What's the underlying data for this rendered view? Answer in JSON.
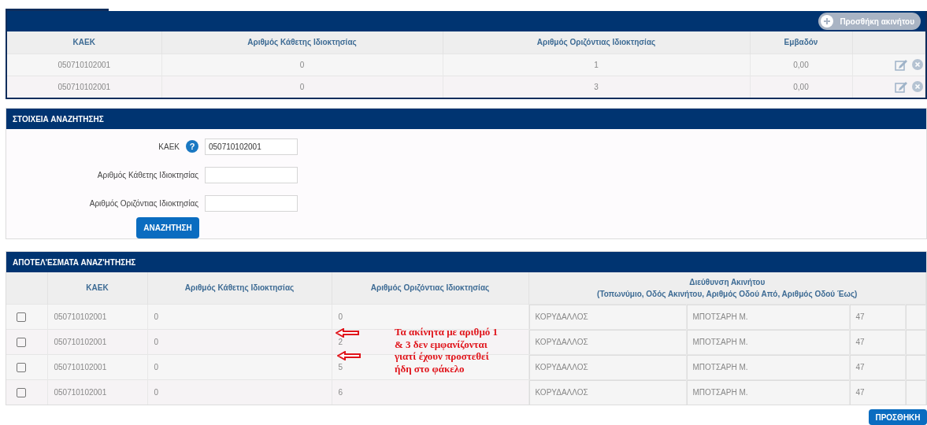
{
  "properties_panel": {
    "add_button": "Προσθήκη ακινήτου",
    "columns": [
      "ΚΑΕΚ",
      "Αριθμός Κάθετης Ιδιοκτησίας",
      "Αριθμός Οριζόντιας Ιδιοκτησίας",
      "Εμβαδόν"
    ],
    "rows": [
      {
        "kaek": "050710102001",
        "vertical": "0",
        "horizontal": "1",
        "area": "0,00"
      },
      {
        "kaek": "050710102001",
        "vertical": "0",
        "horizontal": "3",
        "area": "0,00"
      }
    ]
  },
  "search_panel": {
    "title": "ΣΤΟΙΧΕΙΑ ΑΝΑΖΗΤΗΣΗΣ",
    "fields": [
      {
        "label": "ΚΑΕΚ",
        "help": "?",
        "value": "050710102001"
      },
      {
        "label": "Αριθμός Κάθετης Ιδιοκτησίας"
      },
      {
        "label": "Αριθμός Οριζόντιας Ιδιοκτησίας"
      }
    ],
    "search_button": "ΑΝΑΖΗΤΗΣΗ"
  },
  "results_panel": {
    "title": "ΑΠΟΤΕΛ'ΕΣΜΑΤΑ ΑΝΑΖ'ΗΤΗΣΗΣ",
    "columns": [
      "ΚΑΕΚ",
      "Αριθμός Κάθετης Ιδιοκτησίας",
      "Αριθμός Οριζόντιας Ιδιοκτησίας"
    ],
    "address_header": [
      "Διεύθυνση Ακινήτου",
      "(Τοπωνύμιο, Οδός Ακινήτου, Αριθμός Οδού Από, Αριθμός Οδού Έως)"
    ],
    "rows": [
      {
        "checked": false,
        "kaek": "050710102001",
        "vertical": "0",
        "horizontal": "0",
        "place": "ΚΟΡΥΔΑΛΛΟΣ",
        "street": "ΜΠΟΤΣΑΡΗ Μ.",
        "number_from": "47"
      },
      {
        "checked": false,
        "kaek": "050710102001",
        "vertical": "0",
        "horizontal": "2",
        "place": "ΚΟΡΥΔΑΛΛΟΣ",
        "street": "ΜΠΟΤΣΑΡΗ Μ.",
        "number_from": "47"
      },
      {
        "checked": false,
        "kaek": "050710102001",
        "vertical": "0",
        "horizontal": "5",
        "place": "ΚΟΡΥΔΑΛΛΟΣ",
        "street": "ΜΠΟΤΣΑΡΗ Μ.",
        "number_from": "47"
      },
      {
        "checked": false,
        "kaek": "050710102001",
        "vertical": "0",
        "horizontal": "6",
        "place": "ΚΟΡΥΔΑΛΛΟΣ",
        "street": "ΜΠΟΤΣΑΡΗ Μ.",
        "number_from": "47"
      }
    ],
    "annotation": [
      "Τα ακίνητα με αριθμό 1",
      "& 3 δεν εμφανίζονται",
      "γιατί έχουν προστεθεί",
      "ήδη στο φάκελο"
    ],
    "add_button": "ΠΡΟΣΘΗΚΗ"
  }
}
